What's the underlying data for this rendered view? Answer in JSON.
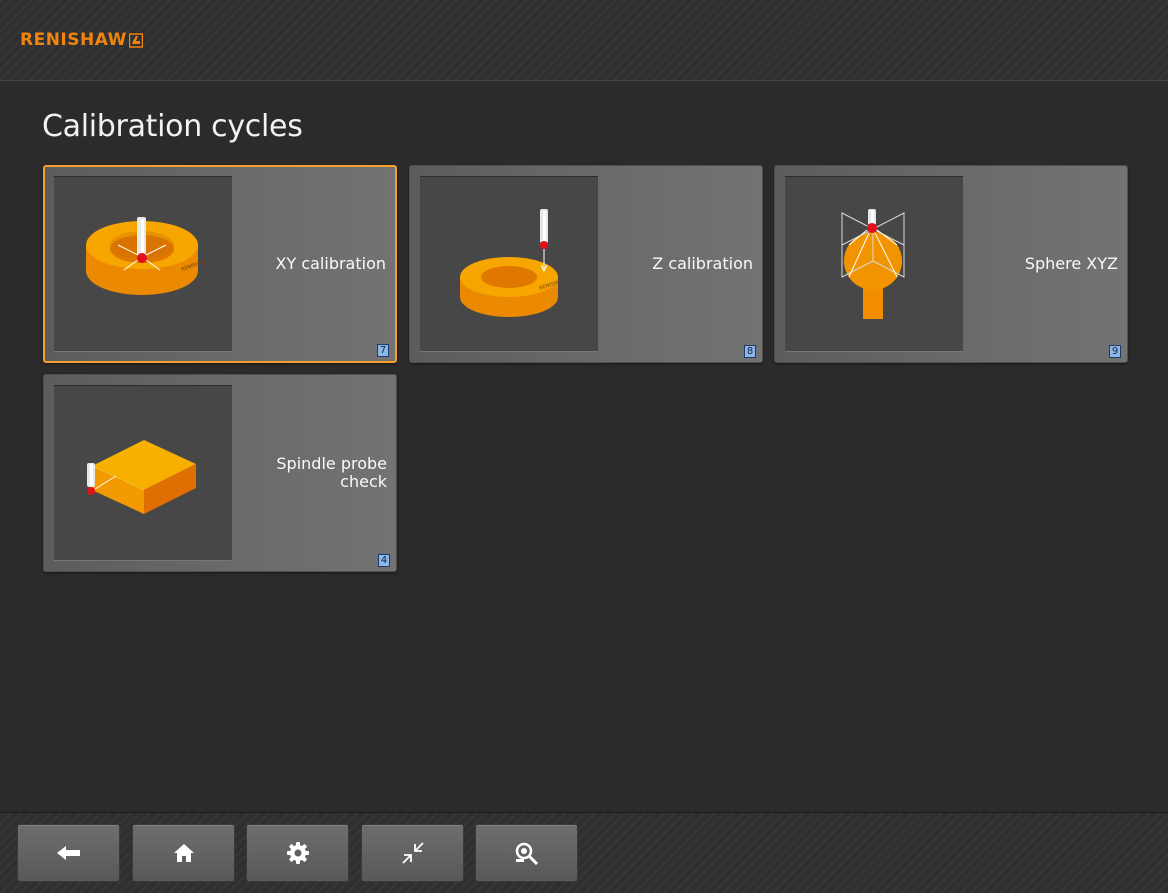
{
  "header": {
    "brand": "RENISHAW"
  },
  "main": {
    "title": "Calibration cycles",
    "tiles": [
      {
        "label": "XY calibration",
        "badge": "7",
        "selected": true,
        "icon": "ring-gauge-xy-icon"
      },
      {
        "label": "Z calibration",
        "badge": "8",
        "selected": false,
        "icon": "ring-gauge-z-icon"
      },
      {
        "label": "Sphere XYZ",
        "badge": "9",
        "selected": false,
        "icon": "sphere-xyz-icon"
      },
      {
        "label": "Spindle probe check",
        "badge": "4",
        "selected": false,
        "icon": "block-probe-check-icon"
      }
    ]
  },
  "footer": {
    "buttons": [
      {
        "name": "back-button",
        "icon": "arrow-left-icon"
      },
      {
        "name": "home-button",
        "icon": "home-icon"
      },
      {
        "name": "settings-button",
        "icon": "gear-icon"
      },
      {
        "name": "minimize-button",
        "icon": "shrink-icon"
      },
      {
        "name": "inspect-button",
        "icon": "magnifier-icon"
      }
    ]
  },
  "colors": {
    "accent": "#f0840f",
    "selection": "#f5a02e",
    "part": "#f7a600",
    "badge": "#8db7e8"
  }
}
